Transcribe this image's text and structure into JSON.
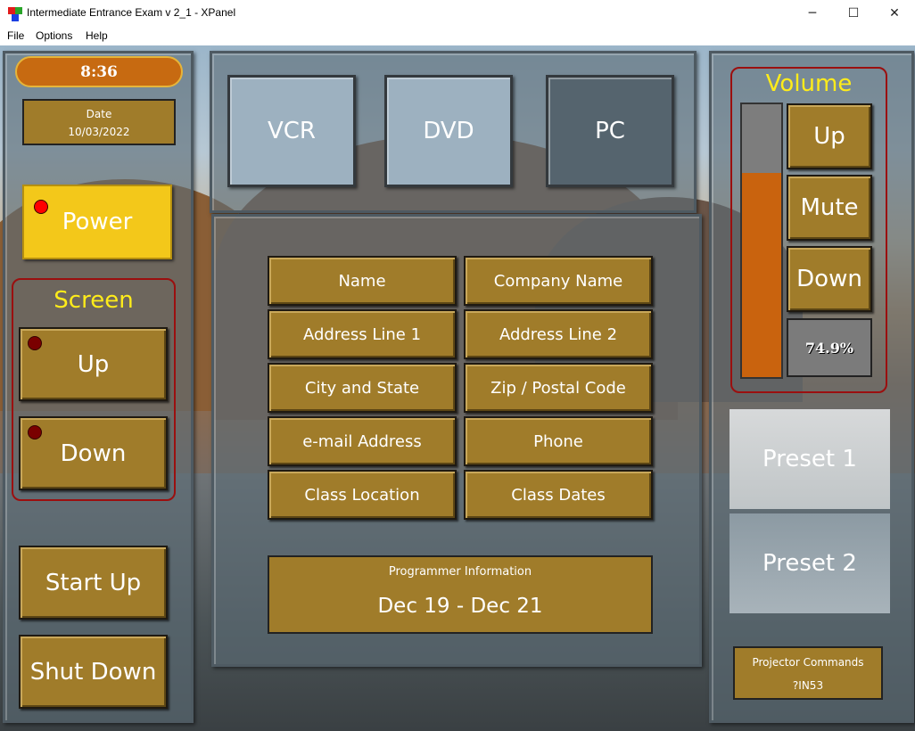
{
  "window": {
    "title": "Intermediate Entrance Exam v 2_1 - XPanel",
    "minimize_glyph": "─",
    "maximize_glyph": "☐",
    "close_glyph": "✕"
  },
  "menu": {
    "items": [
      "File",
      "Options",
      "Help"
    ]
  },
  "left": {
    "clock": "8:36",
    "date_label": "Date",
    "date_value": "10/03/2022",
    "power_label": "Power",
    "screen": {
      "title": "Screen",
      "up_label": "Up",
      "down_label": "Down"
    },
    "startup_label": "Start Up",
    "shutdown_label": "Shut Down"
  },
  "sources": [
    {
      "label": "VCR",
      "active": false
    },
    {
      "label": "DVD",
      "active": false
    },
    {
      "label": "PC",
      "active": true
    }
  ],
  "info_buttons": [
    "Name",
    "Company Name",
    "Address Line 1",
    "Address Line 2",
    "City and State",
    "Zip / Postal Code",
    "e-mail Address",
    "Phone",
    "Class Location",
    "Class Dates"
  ],
  "programmer": {
    "label": "Programmer Information",
    "value": "Dec 19 - Dec 21"
  },
  "volume": {
    "title": "Volume",
    "up_label": "Up",
    "mute_label": "Mute",
    "down_label": "Down",
    "level_text": "74.9%",
    "level_fraction": 0.749
  },
  "presets": [
    "Preset 1",
    "Preset 2"
  ],
  "projector": {
    "label": "Projector Commands",
    "value": "?IN53"
  },
  "colors": {
    "gold_button": "#a07c2a",
    "power_active": "#f3c81a",
    "volume_fill": "#c9630e",
    "group_border": "#9b0f0f",
    "group_title": "#ffec1a",
    "led_on": "#ff0000",
    "led_off": "#7a0000"
  }
}
